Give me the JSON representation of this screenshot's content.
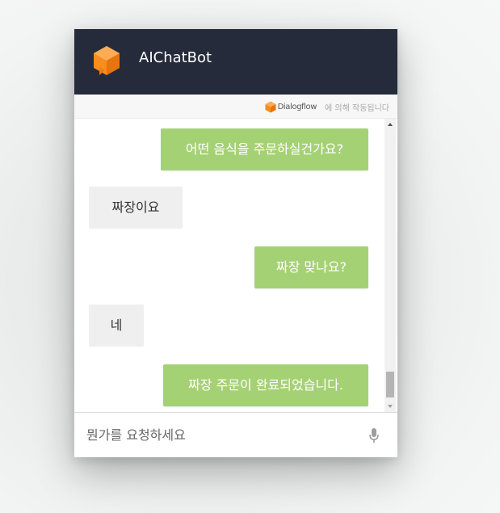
{
  "header": {
    "title": "AIChatBot",
    "accent": "#f68d1e",
    "background": "#252b3a"
  },
  "powered_by": {
    "brand": "Dialogflow",
    "suffix": "에 의해 작동됩니다"
  },
  "messages": [
    {
      "from": "bot",
      "text": "어떤 음식을 주문하실건가요?"
    },
    {
      "from": "user",
      "text": "짜장이요"
    },
    {
      "from": "bot",
      "text": "짜장 맞나요?"
    },
    {
      "from": "user",
      "text": "네"
    },
    {
      "from": "bot",
      "text": "짜장 주문이 완료되었습니다."
    }
  ],
  "colors": {
    "bot_bubble": "#a5d175",
    "user_bubble": "#efefef"
  },
  "input": {
    "placeholder": "뭔가를 요청하세요"
  },
  "icons": {
    "logo": "dialogflow-cube-icon",
    "mic": "microphone-icon",
    "scroll_up": "scroll-up-arrow-icon",
    "scroll_down": "scroll-down-arrow-icon"
  }
}
